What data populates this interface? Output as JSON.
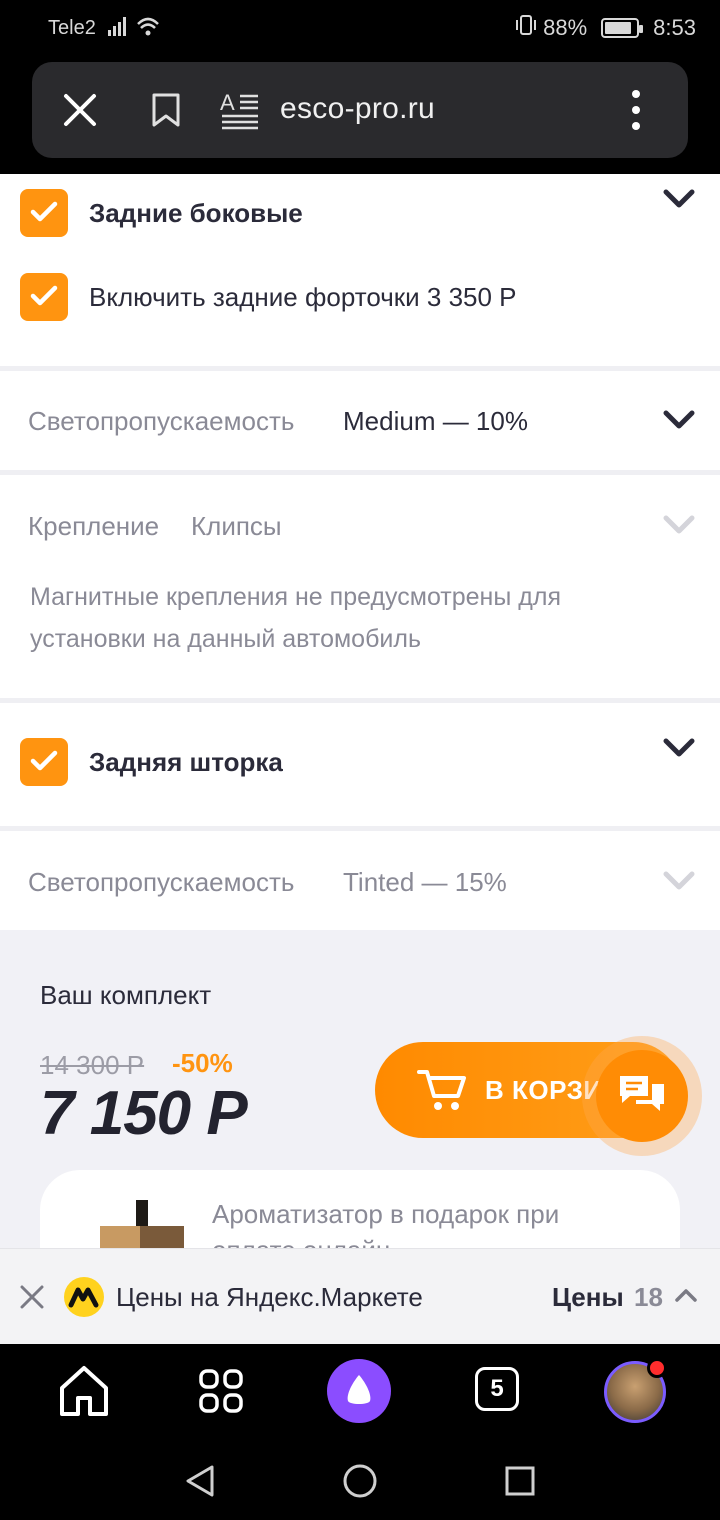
{
  "status_bar": {
    "carrier": "Tele2",
    "battery": "88%",
    "time": "8:53"
  },
  "browser": {
    "url": "esco-pro.ru",
    "icons": [
      "close-icon",
      "bookmark-icon",
      "reader-mode-icon",
      "more-menu-icon"
    ]
  },
  "options": {
    "rear_side": {
      "title": "Задние боковые",
      "checked": true,
      "vent_label": "Включить задние форточки 3 350 Р",
      "vent_checked": true
    },
    "rear_side_transmission": {
      "label": "Светопропускаемость",
      "value": "Medium — 10%"
    },
    "mount": {
      "label": "Крепление",
      "value": "Клипсы",
      "note": "Магнитные крепления не предусмотрены для установки на данный автомобиль"
    },
    "rear_blind": {
      "title": "Задняя шторка",
      "checked": true
    },
    "rear_blind_transmission": {
      "label": "Светопропускаемость",
      "value": "Tinted — 15%"
    }
  },
  "kit": {
    "title": "Ваш комплект",
    "old_price": "14 300 Р",
    "discount": "-50%",
    "price": "7 150 Р",
    "cart_button": "В КОРЗИ",
    "gift_text": "Ароматизатор в подарок при оплате онлайн"
  },
  "market": {
    "text": "Цены на Яндекс.Маркете",
    "prices_label": "Цены",
    "prices_count": "18"
  },
  "nav": {
    "tabs_count": "5"
  },
  "colors": {
    "accent": "#ff9410",
    "alice": "#8b4dff"
  }
}
